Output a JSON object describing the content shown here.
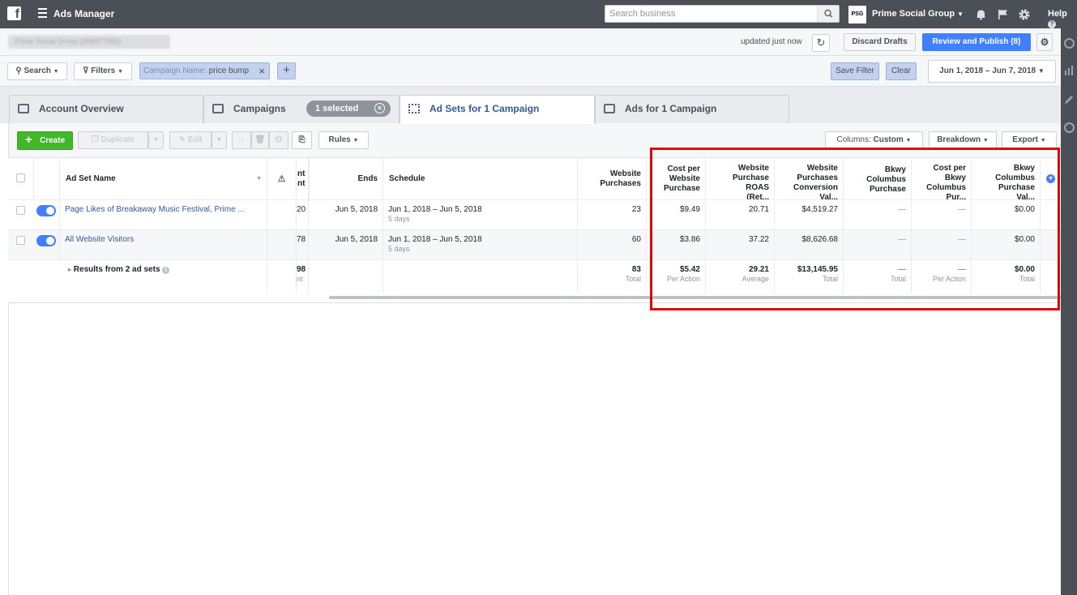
{
  "topbar": {
    "app_title": "Ads Manager",
    "search_placeholder": "Search business",
    "business_logo_text": "PSG",
    "business_name": "Prime Social Group",
    "help_label": "Help"
  },
  "crumb": {
    "account_name": "Prime Social Group (308377355)",
    "updated_text": "updated just now",
    "discard_label": "Discard Drafts",
    "review_label": "Review and Publish (8)"
  },
  "filters": {
    "search_label": "Search",
    "filters_label": "Filters",
    "chip_key": "Campaign Name:",
    "chip_value": "price bump",
    "save_filter_label": "Save Filter",
    "clear_label": "Clear",
    "date_range": "Jun 1, 2018 – Jun 7, 2018"
  },
  "tabs": [
    {
      "label": "Account Overview"
    },
    {
      "label": "Campaigns"
    },
    {
      "label": "Ad Sets for 1 Campaign"
    },
    {
      "label": "Ads for 1 Campaign"
    }
  ],
  "selected_pill": "1 selected",
  "toolbar": {
    "create_label": "Create",
    "duplicate_label": "Duplicate",
    "edit_label": "Edit",
    "rules_label": "Rules",
    "columns_prefix": "Columns:",
    "columns_value": "Custom",
    "breakdown_label": "Breakdown",
    "export_label": "Export"
  },
  "table": {
    "headers": {
      "ad_set_name": "Ad Set Name",
      "amount_spent_fragment_1": "nt",
      "amount_spent_fragment_2": "nt",
      "ends": "Ends",
      "schedule": "Schedule",
      "website_purchases_1": "Website",
      "website_purchases_2": "Purchases",
      "cost_per_purchase": [
        "Cost per",
        "Website",
        "Purchase"
      ],
      "purchase_roas": [
        "Website",
        "Purchase",
        "ROAS",
        "(Ret..."
      ],
      "conversion_value": [
        "Website",
        "Purchases",
        "Conversion",
        "Val..."
      ],
      "bkwy_purchase": [
        "Bkwy",
        "Columbus",
        "Purchase"
      ],
      "cost_per_bkwy": [
        "Cost per",
        "Bkwy",
        "Columbus",
        "Pur..."
      ],
      "bkwy_purchase_value": [
        "Bkwy",
        "Columbus",
        "Purchase",
        "Val..."
      ]
    },
    "rows": [
      {
        "name": "Page Likes of Breakaway Music Festival, Prime ...",
        "amount_fragment": "20",
        "ends": "Jun 5, 2018",
        "schedule": "Jun 1, 2018 – Jun 5, 2018",
        "schedule_sub": "5 days",
        "website_purchases": "23",
        "cost_per_purchase": "$9.49",
        "roas": "20.71",
        "conversion_value": "$4,519.27",
        "bkwy_purchase": "—",
        "cost_per_bkwy": "—",
        "bkwy_value": "$0.00"
      },
      {
        "name": "All Website Visitors",
        "amount_fragment": "78",
        "ends": "Jun 5, 2018",
        "schedule": "Jun 1, 2018 – Jun 5, 2018",
        "schedule_sub": "5 days",
        "website_purchases": "60",
        "cost_per_purchase": "$3.86",
        "roas": "37.22",
        "conversion_value": "$8,626.68",
        "bkwy_purchase": "—",
        "cost_per_bkwy": "—",
        "bkwy_value": "$0.00"
      }
    ],
    "totals": {
      "label": "Results from 2 ad sets",
      "amount_fragment": "98",
      "amount_sub": "nt",
      "website_purchases": "83",
      "website_purchases_sub": "Total",
      "cost_per_purchase": "$5.42",
      "cost_per_purchase_sub": "Per Action",
      "roas": "29.21",
      "roas_sub": "Average",
      "conversion_value": "$13,145.95",
      "conversion_value_sub": "Total",
      "bkwy_purchase": "—",
      "bkwy_purchase_sub": "Total",
      "cost_per_bkwy": "—",
      "cost_per_bkwy_sub": "Per Action",
      "bkwy_value": "$0.00",
      "bkwy_value_sub": "Total"
    }
  },
  "colors": {
    "topbar": "#4b4f56",
    "primary_blue": "#4080ff",
    "create_green": "#42b72a",
    "highlight_red": "#e0070b",
    "link": "#365899"
  }
}
